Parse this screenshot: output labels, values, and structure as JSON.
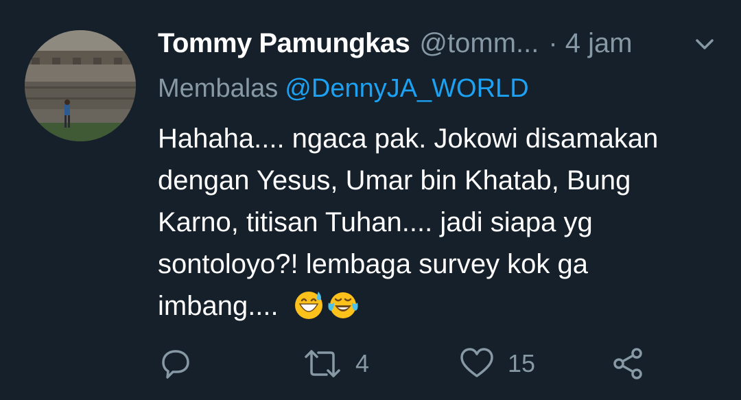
{
  "tweet": {
    "author_name": "Tommy Pamungkas",
    "handle": "@tomm...",
    "time": "· 4 jam",
    "reply_prefix": "Membalas",
    "reply_target": "@DennyJA_WORLD",
    "body_lines": [
      "Hahaha.... ngaca pak. Jokowi disamakan",
      "dengan Yesus, Umar bin Khatab, Bung",
      "Karno, titisan Tuhan.... jadi siapa yg",
      "sontoloyo?! lembaga survey kok ga",
      "imbang...."
    ],
    "emojis": [
      "grinning-sweat-emoji",
      "tears-of-joy-emoji"
    ]
  },
  "actions": {
    "reply": {
      "icon": "reply-icon",
      "count": ""
    },
    "retweet": {
      "icon": "retweet-icon",
      "count": "4"
    },
    "like": {
      "icon": "heart-icon",
      "count": "15"
    },
    "share": {
      "icon": "share-icon",
      "count": ""
    }
  },
  "colors": {
    "background": "#15202b",
    "text_primary": "#ffffff",
    "text_secondary": "#8899a6",
    "link": "#1da1f2"
  }
}
